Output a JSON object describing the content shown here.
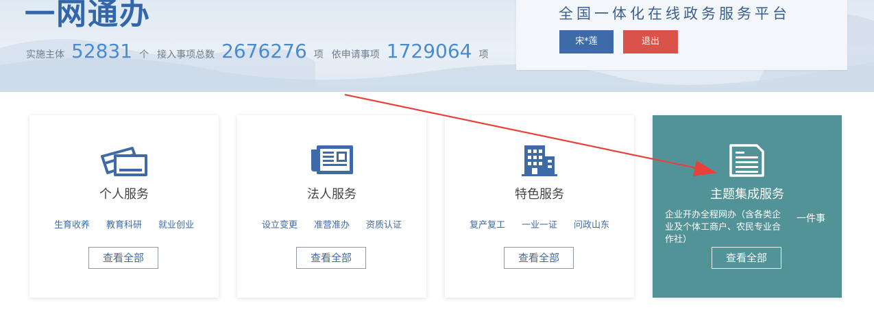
{
  "banner": {
    "title": "一网通办",
    "stats": [
      {
        "label": "实施主体",
        "value": "52831",
        "unit": "个"
      },
      {
        "label": "接入事项总数",
        "value": "2676276",
        "unit": "项"
      },
      {
        "label": "依申请事项",
        "value": "1729064",
        "unit": "项"
      }
    ]
  },
  "login": {
    "platform_title": "全国一体化在线政务服务平台",
    "user_button": "宋*莲",
    "logout_button": "退出"
  },
  "cards": [
    {
      "title": "个人服务",
      "links": [
        "生育收养",
        "教育科研",
        "就业创业"
      ],
      "view_all": "查看全部",
      "icon": "id-card-icon"
    },
    {
      "title": "法人服务",
      "links": [
        "设立变更",
        "准营准办",
        "资质认证"
      ],
      "view_all": "查看全部",
      "icon": "newspaper-icon"
    },
    {
      "title": "特色服务",
      "links": [
        "复产复工",
        "一业一证",
        "问政山东"
      ],
      "view_all": "查看全部",
      "icon": "building-icon"
    },
    {
      "title": "主题集成服务",
      "links": [
        "企业开办全程网办（含各类企业及个体工商户、农民专业合作社）",
        "一件事"
      ],
      "view_all": "查看全部",
      "icon": "document-icon"
    }
  ],
  "colors": {
    "primary": "#3f6aa8",
    "logout": "#d9534a",
    "theme_card": "#519396",
    "annotation_arrow": "#e8413c"
  }
}
